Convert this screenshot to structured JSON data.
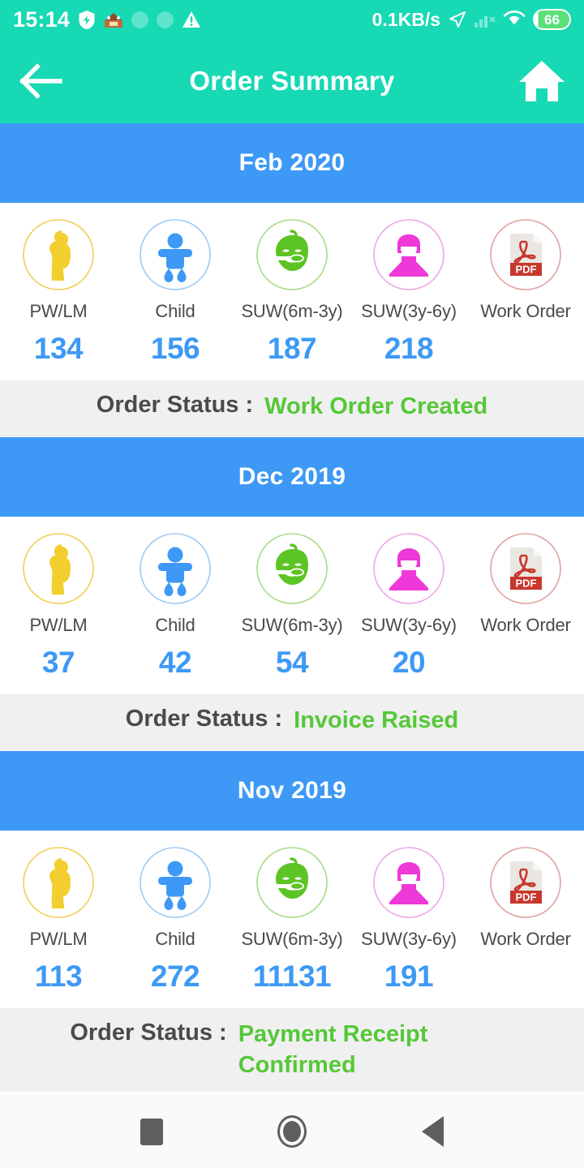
{
  "status_bar": {
    "time": "15:14",
    "network_speed": "0.1KB/s",
    "battery_level": "66",
    "icons": [
      "shield-bolt-icon",
      "app-badge-icon",
      "circle-icon",
      "circle-icon",
      "warning-triangle-icon",
      "location-arrow-icon",
      "signal-bars-off-icon",
      "wifi-icon",
      "battery-icon"
    ]
  },
  "appbar": {
    "title": "Order Summary",
    "back_icon": "arrow-left-icon",
    "home_icon": "home-icon"
  },
  "categories": [
    {
      "key": "pw_lm",
      "label": "PW/LM",
      "icon": "pregnant-woman-icon",
      "color": "#F2CE2E",
      "ring": "#F2CE2E"
    },
    {
      "key": "child",
      "label": "Child",
      "icon": "baby-icon",
      "color": "#3D99F5",
      "ring": "#9CCBF7"
    },
    {
      "key": "suw_6m",
      "label": "SUW(6m-3y)",
      "icon": "baby-feeding-icon",
      "color": "#5CC424",
      "ring": "#A7DC84"
    },
    {
      "key": "suw_3y",
      "label": "SUW(3y-6y)",
      "icon": "girl-icon",
      "color": "#EE38D8",
      "ring": "#EFA7E6"
    },
    {
      "key": "work_order",
      "label": "Work Order",
      "icon": "pdf-file-icon",
      "color": "#C8372D",
      "ring": "#DFA3A0"
    }
  ],
  "status_label": "Order Status :",
  "orders": [
    {
      "month": "Feb 2020",
      "values": [
        "134",
        "156",
        "187",
        "218"
      ],
      "status": "Work Order Created"
    },
    {
      "month": "Dec 2019",
      "values": [
        "37",
        "42",
        "54",
        "20"
      ],
      "status": "Invoice Raised"
    },
    {
      "month": "Nov 2019",
      "values": [
        "113",
        "272",
        "11131",
        "191"
      ],
      "status": "Payment Receipt Confirmed"
    }
  ],
  "navbar": {
    "recents_icon": "square-recents-icon",
    "home_icon": "circle-home-icon",
    "back_icon": "triangle-back-icon"
  },
  "colors": {
    "header_teal": "#17D9B4",
    "month_blue": "#3D99F5",
    "number_blue": "#3D99F5",
    "status_green": "#55C838",
    "status_row_bg": "#F0F0F0"
  }
}
